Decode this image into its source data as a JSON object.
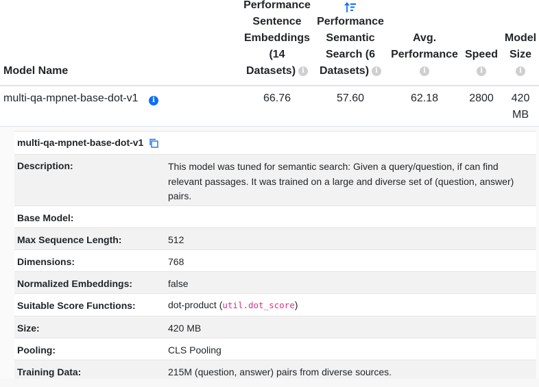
{
  "header": {
    "model_name": "Model Name",
    "sentence_perf": [
      "Performance",
      "Sentence",
      "Embeddings",
      "(14",
      "Datasets)"
    ],
    "semantic_perf": [
      "Performance",
      "Semantic",
      "Search (6",
      "Datasets)"
    ],
    "avg_perf": [
      "Avg.",
      "Performance"
    ],
    "speed": "Speed",
    "model_size": [
      "Model",
      "Size"
    ],
    "icons": {
      "info": "info-circle-icon",
      "sort": "sort-descending-icon"
    }
  },
  "row": {
    "name": "multi-qa-mpnet-base-dot-v1",
    "sentence_perf": "66.76",
    "semantic_perf": "57.60",
    "avg_perf": "62.18",
    "speed": "2800",
    "size_num": "420",
    "size_unit": "MB"
  },
  "details": {
    "title": "multi-qa-mpnet-base-dot-v1",
    "description_label": "Description:",
    "description_lines": [
      "This model was tuned for semantic search: Given a query/question, if can find",
      "relevant passages. It was trained on a large and diverse set of (question, answer)",
      "pairs."
    ],
    "base_model_label": "Base Model:",
    "base_model": "",
    "max_seq_label": "Max Sequence Length:",
    "max_seq": "512",
    "dimensions_label": "Dimensions:",
    "dimensions": "768",
    "normalized_label": "Normalized Embeddings:",
    "normalized": "false",
    "score_label": "Suitable Score Functions:",
    "score_prefix": "dot-product (",
    "score_code": "util.dot_score",
    "score_suffix": ")",
    "size_label": "Size:",
    "size": "420 MB",
    "pooling_label": "Pooling:",
    "pooling": "CLS Pooling",
    "training_label": "Training Data:",
    "training": "215M (question, answer) pairs from diverse sources."
  },
  "colors": {
    "accent": "#0d6efd",
    "code": "#d63384",
    "muted_icon": "#cfcfcf"
  }
}
